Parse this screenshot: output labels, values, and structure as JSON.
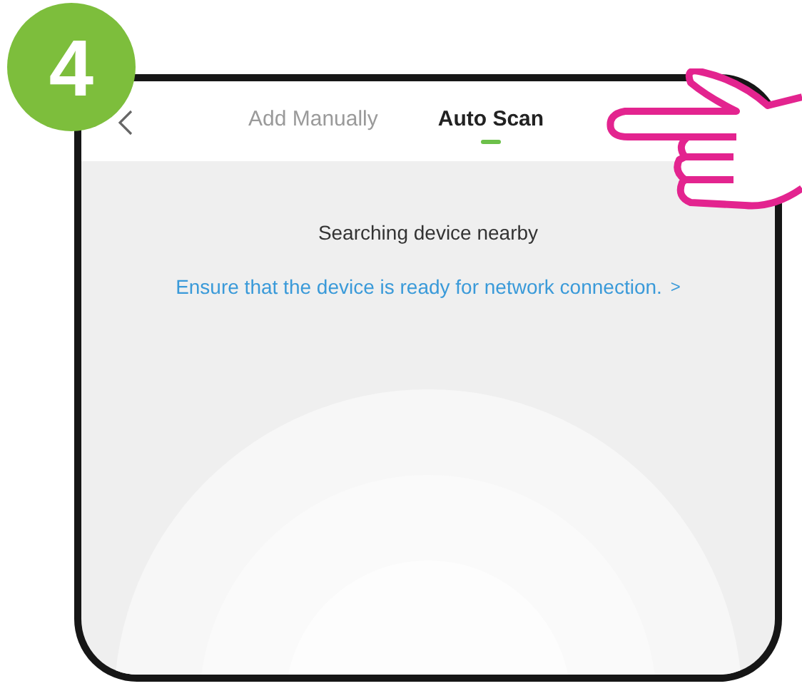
{
  "step_badge": "4",
  "tabs": [
    {
      "label": "Add Manually",
      "selected": false
    },
    {
      "label": "Auto Scan",
      "selected": true
    }
  ],
  "status": "Searching device nearby",
  "hint": {
    "text": "Ensure that the device is ready for network connection.",
    "arrow": ">"
  }
}
